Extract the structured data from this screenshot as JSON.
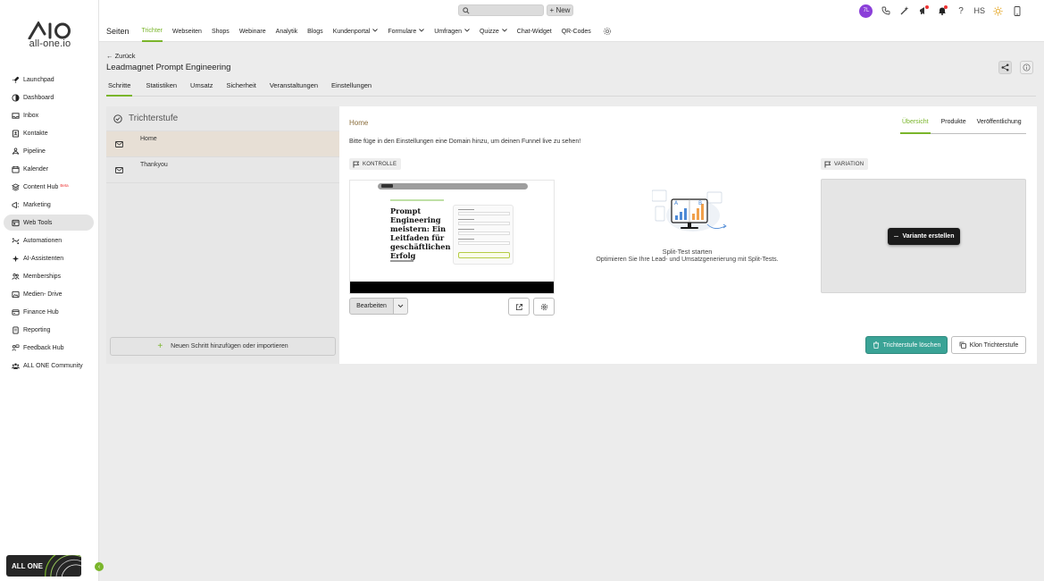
{
  "brand": {
    "logo_text": "AIO",
    "url": "all-one.io",
    "card_label": "ALL ONE",
    "accent": "#7ab52b"
  },
  "sidebar": {
    "items": [
      {
        "label": "Launchpad",
        "icon": "rocket-icon"
      },
      {
        "label": "Dashboard",
        "icon": "gauge-icon"
      },
      {
        "label": "Inbox",
        "icon": "inbox-icon"
      },
      {
        "label": "Kontakte",
        "icon": "contacts-icon"
      },
      {
        "label": "Pipeline",
        "icon": "pipeline-icon"
      },
      {
        "label": "Kalender",
        "icon": "calendar-icon"
      },
      {
        "label": "Content Hub",
        "icon": "content-hub-icon",
        "badge": "Beta"
      },
      {
        "label": "Marketing",
        "icon": "megaphone-icon"
      },
      {
        "label": "Web Tools",
        "icon": "web-tools-icon",
        "active": true
      },
      {
        "label": "Automationen",
        "icon": "automation-icon"
      },
      {
        "label": "AI-Assistenten",
        "icon": "sparkle-icon"
      },
      {
        "label": "Memberships",
        "icon": "members-icon"
      },
      {
        "label": "Medien- Drive",
        "icon": "media-icon"
      },
      {
        "label": "Finance Hub",
        "icon": "finance-icon"
      },
      {
        "label": "Reporting",
        "icon": "report-icon"
      },
      {
        "label": "Feedback Hub",
        "icon": "feedback-icon"
      },
      {
        "label": "ALL ONE Community",
        "icon": "community-icon"
      }
    ]
  },
  "topbar": {
    "search_placeholder": "",
    "new_label": "+ New",
    "avatar_initials": "7L",
    "user_initials": "HS",
    "avatar_color": "#8b3fd9"
  },
  "subnav": {
    "title": "Seiten",
    "tabs": [
      {
        "label": "Trichter",
        "active": true
      },
      {
        "label": "Webseiten"
      },
      {
        "label": "Shops"
      },
      {
        "label": "Webinare"
      },
      {
        "label": "Analytik"
      },
      {
        "label": "Blogs"
      },
      {
        "label": "Kundenportal",
        "dropdown": true
      },
      {
        "label": "Formulare",
        "dropdown": true
      },
      {
        "label": "Umfragen",
        "dropdown": true
      },
      {
        "label": "Quizze",
        "dropdown": true
      },
      {
        "label": "Chat-Widget"
      },
      {
        "label": "QR-Codes"
      }
    ]
  },
  "page": {
    "back_label": "← Zurück",
    "title": "Leadmagnet Prompt Engineering",
    "tabs": [
      "Schritte",
      "Statistiken",
      "Umsatz",
      "Sicherheit",
      "Veranstaltungen",
      "Einstellungen"
    ]
  },
  "steps_panel": {
    "header": "Trichterstufe",
    "steps": [
      {
        "label": "Home",
        "active": true
      },
      {
        "label": "Thankyou"
      }
    ],
    "add_label": "Neuen Schritt hinzufügen oder importieren"
  },
  "detail": {
    "step_name": "Home",
    "tabs": [
      "Übersicht",
      "Produkte",
      "Veröffentlichung"
    ],
    "notice": "Bitte füge in den Einstellungen eine Domain hinzu, um deinen Funnel live zu sehen!",
    "control_badge": "KONTROLLE",
    "variation_badge": "VARIATION",
    "preview_title": "Prompt Engineering meistern: Ein Leitfaden für geschäftlichen Erfolg",
    "edit_label": "Bearbeiten",
    "split_title": "Split-Test starten",
    "split_sub": "Optimieren Sie Ihre Lead- und Umsatzgenerierung mit Split-Tests.",
    "create_variant_label": "Variante erstellen",
    "delete_label": "Trichterstufe löschen",
    "clone_label": "Klon Trichterstufe",
    "delete_color": "#3aa396"
  }
}
